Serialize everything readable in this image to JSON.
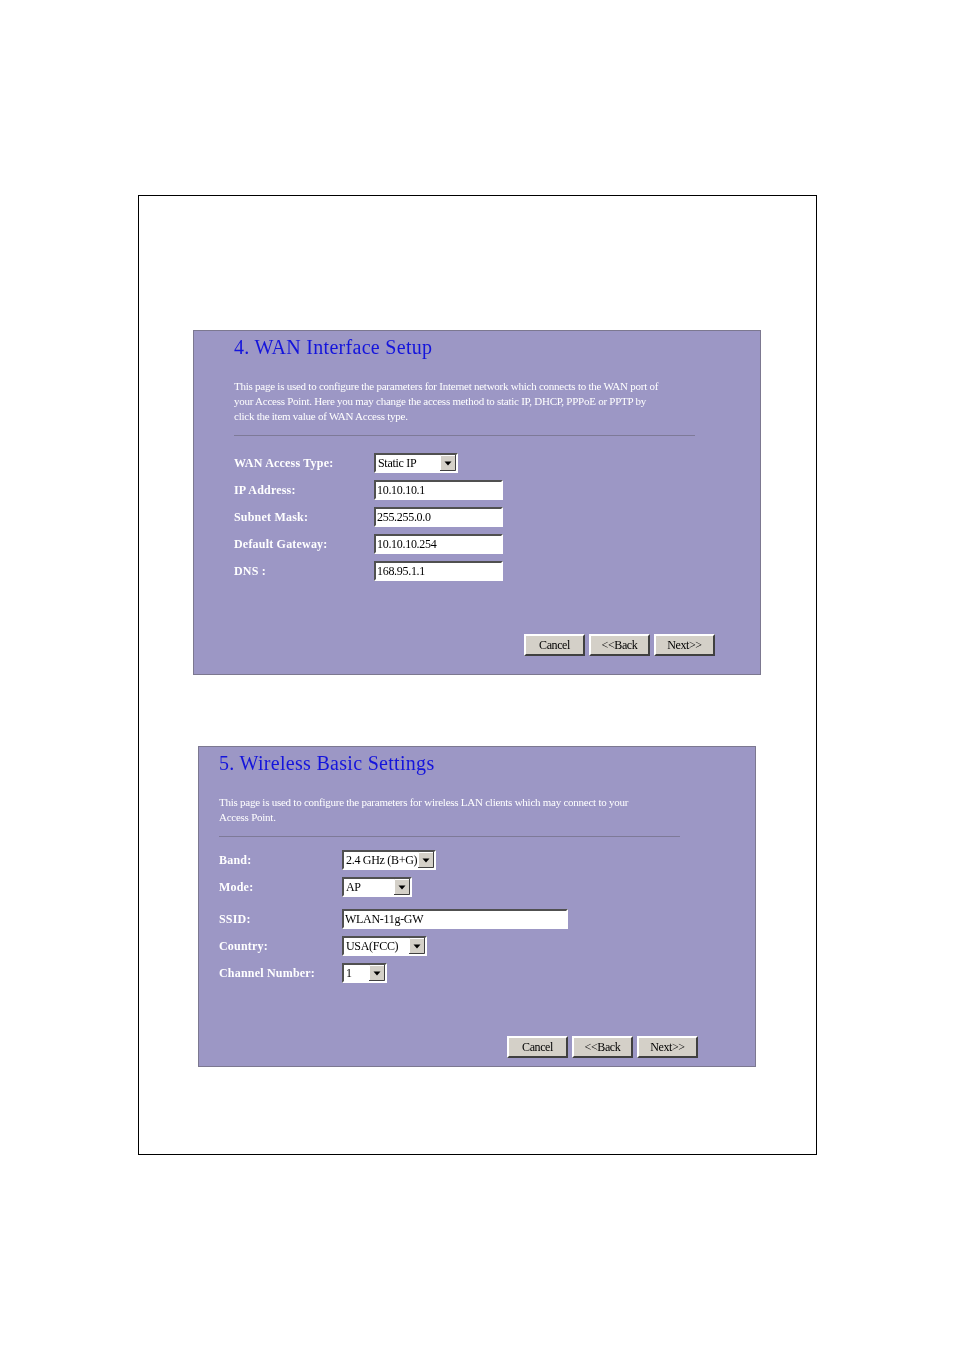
{
  "panels": [
    {
      "title": "4. WAN Interface Setup",
      "description": "This page is used to configure the parameters for Internet network which connects to the WAN port of your Access Point. Here you may change the access method to static IP, DHCP, PPPoE or PPTP by click the item value of WAN Access type.",
      "fields": [
        {
          "kind": "select",
          "label": "WAN Access Type:",
          "value": "Static IP"
        },
        {
          "kind": "text",
          "label": "IP Address:",
          "value": "10.10.10.1"
        },
        {
          "kind": "text",
          "label": "Subnet Mask:",
          "value": "255.255.0.0"
        },
        {
          "kind": "text",
          "label": "Default Gateway:",
          "value": "10.10.10.254"
        },
        {
          "kind": "text",
          "label": "DNS :",
          "value": "168.95.1.1"
        }
      ],
      "buttons": [
        "Cancel",
        "<<Back",
        "Next>>"
      ]
    },
    {
      "title": "5. Wireless Basic Settings",
      "description": "This page is used to configure the parameters for wireless LAN clients which may connect to your Access Point.",
      "fields": [
        {
          "kind": "select",
          "label": "Band:",
          "value": "2.4 GHz (B+G)"
        },
        {
          "kind": "select",
          "label": "Mode:",
          "value": "AP"
        },
        {
          "kind": "text",
          "label": "SSID:",
          "value": "WLAN-11g-GW"
        },
        {
          "kind": "select",
          "label": "Country:",
          "value": "USA(FCC)"
        },
        {
          "kind": "select",
          "label": "Channel Number:",
          "value": "1"
        }
      ],
      "buttons": [
        "Cancel",
        "<<Back",
        "Next>>"
      ]
    }
  ]
}
